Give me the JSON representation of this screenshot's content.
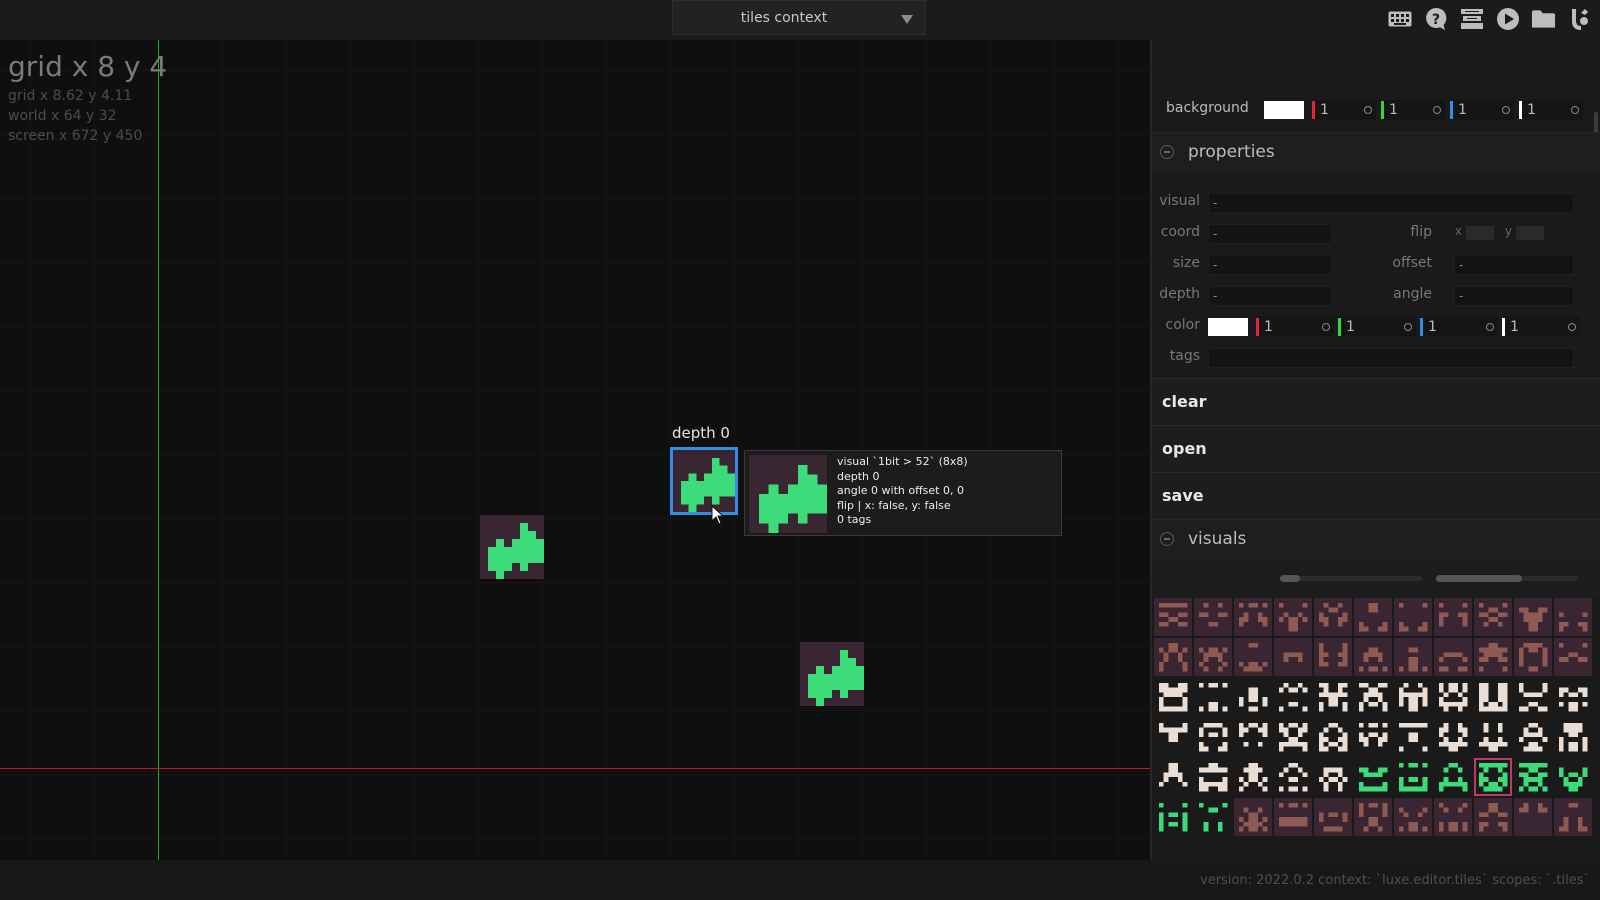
{
  "topbar": {
    "context": "tiles context",
    "tools": [
      {
        "icon": "keyboard-icon"
      },
      {
        "icon": "help-icon"
      },
      {
        "icon": "layers-icon"
      },
      {
        "icon": "play-icon"
      },
      {
        "icon": "folder-icon"
      },
      {
        "icon": "luxe-logo-icon"
      }
    ]
  },
  "viewport": {
    "grid_main": "grid x 8 y 4",
    "grid_precise": "grid x 8.62 y 4.11",
    "world": "world x 64 y 32",
    "screen": "screen x 672 y 450",
    "depth_label": "depth 0",
    "tooltip": {
      "visual": "visual `1bit > 52` (8x8)",
      "depth": "depth 0",
      "angle": "angle 0 with offset 0, 0",
      "flip": "flip | x: false, y: false",
      "tags": "0 tags"
    }
  },
  "panel": {
    "background": {
      "label": "background",
      "swatch": "#ffffff",
      "r": "1",
      "g": "1",
      "b": "1",
      "a": "1"
    },
    "properties": {
      "title": "properties",
      "visual_label": "visual",
      "visual_value": "-",
      "coord_label": "coord",
      "coord_value": "-",
      "size_label": "size",
      "size_value": "-",
      "depth_label": "depth",
      "depth_value": "-",
      "flip_label": "flip",
      "flip_x": "x",
      "flip_y": "y",
      "offset_label": "offset",
      "offset_value": "-",
      "angle_label": "angle",
      "angle_value": "-",
      "color_label": "color",
      "color_swatch": "#ffffff",
      "r": "1",
      "g": "1",
      "b": "1",
      "a": "1",
      "tags_label": "tags"
    },
    "actions": {
      "clear": "clear",
      "open": "open",
      "save": "save"
    },
    "visuals": {
      "title": "visuals"
    }
  },
  "status": "version: 2022.0.2 context: `luxe.editor.tiles` scopes: `.tiles`",
  "colors": {
    "accent": "#2f8fe6",
    "tree": "#3ddc7a",
    "tile_bg": "#3a2632",
    "x_axis": "#c21a2d",
    "y_axis": "#22a82a",
    "channel_r": "#e0243c",
    "channel_g": "#3cd23c",
    "channel_b": "#2f8fe6",
    "channel_a": "#ffffff"
  }
}
